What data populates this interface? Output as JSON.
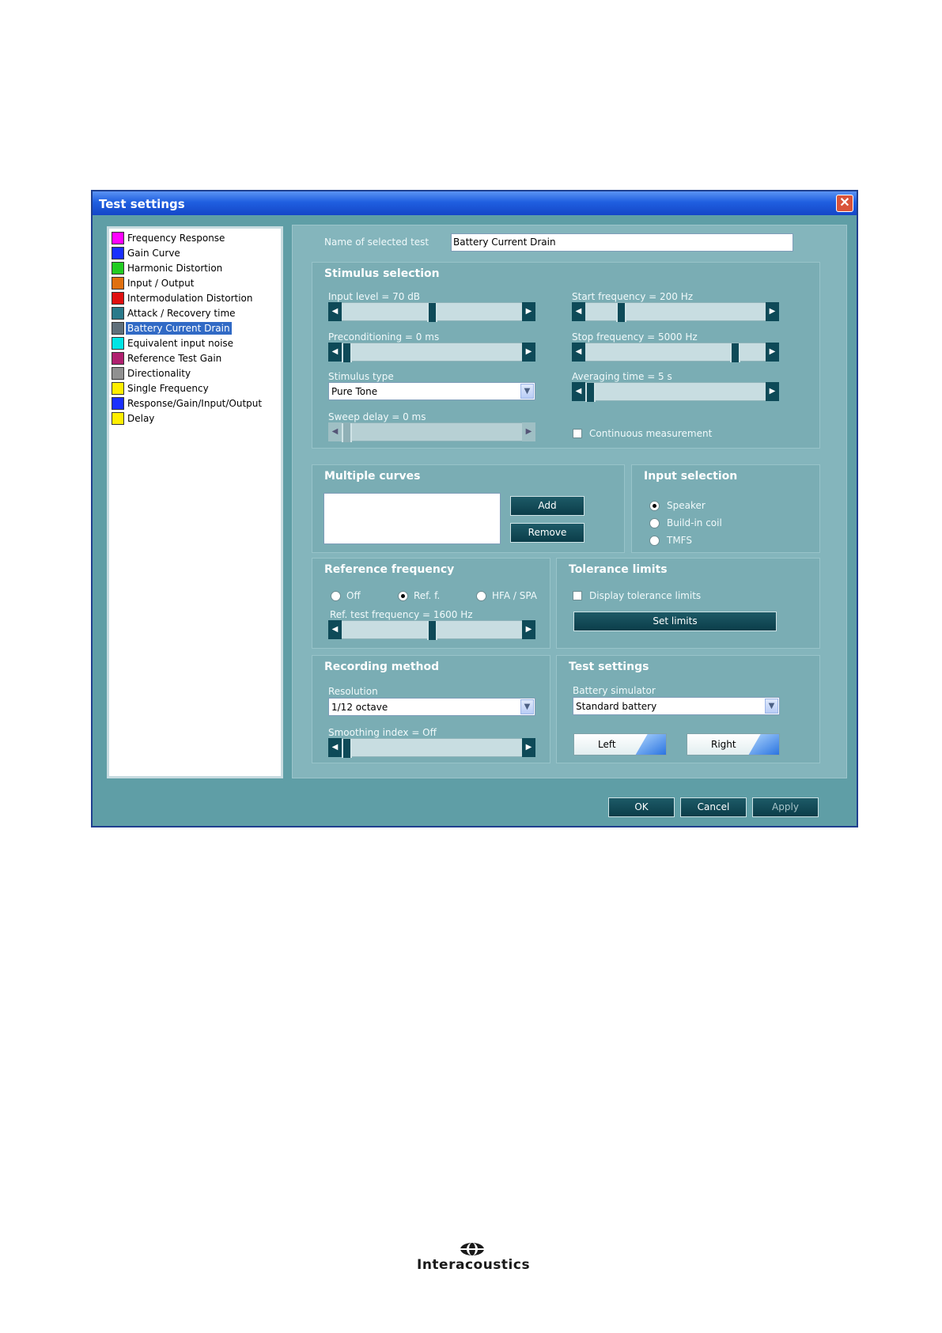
{
  "window": {
    "title": "Test settings",
    "close_symbol": "✕"
  },
  "test_list": [
    {
      "label": "Frequency Response",
      "icon": "frequency-response-icon",
      "color": "#ff00ff"
    },
    {
      "label": "Gain Curve",
      "icon": "gain-curve-icon",
      "color": "#1a2fff"
    },
    {
      "label": "Harmonic Distortion",
      "icon": "harmonic-distortion-icon",
      "color": "#22cc22"
    },
    {
      "label": "Input / Output",
      "icon": "input-output-icon",
      "color": "#e07010"
    },
    {
      "label": "Intermodulation Distortion",
      "icon": "intermodulation-distortion-icon",
      "color": "#e01010"
    },
    {
      "label": "Attack / Recovery time",
      "icon": "attack-recovery-icon",
      "color": "#2a7a8a"
    },
    {
      "label": "Battery Current Drain",
      "icon": "battery-current-drain-icon",
      "color": "#5f6f7a",
      "selected": true
    },
    {
      "label": "Equivalent input noise",
      "icon": "equivalent-input-noise-icon",
      "color": "#00e5e5"
    },
    {
      "label": "Reference Test Gain",
      "icon": "reference-test-gain-icon",
      "color": "#b0206f"
    },
    {
      "label": "Directionality",
      "icon": "directionality-icon",
      "color": "#909090"
    },
    {
      "label": "Single Frequency",
      "icon": "single-frequency-icon",
      "color": "#ffee00"
    },
    {
      "label": "Response/Gain/Input/Output",
      "icon": "response-gain-input-output-icon",
      "color": "#1a2fff"
    },
    {
      "label": "Delay",
      "icon": "delay-icon",
      "color": "#ffee00"
    }
  ],
  "name_of_test": {
    "label": "Name of selected test",
    "value": "Battery Current Drain"
  },
  "stimulus": {
    "title": "Stimulus selection",
    "input_level": {
      "label": "Input level = 70 dB",
      "position": 0.5
    },
    "preconditioning": {
      "label": "Preconditioning = 0 ms",
      "position": 0.0
    },
    "stimulus_type": {
      "label": "Stimulus type",
      "value": "Pure Tone"
    },
    "sweep_delay": {
      "label": "Sweep delay = 0 ms",
      "position": 0.0
    },
    "start_frequency": {
      "label": "Start frequency = 200 Hz",
      "position": 0.18
    },
    "stop_frequency": {
      "label": "Stop frequency = 5000 Hz",
      "position": 0.85
    },
    "averaging_time": {
      "label": "Averaging time = 5 s",
      "position": 0.0
    },
    "continuous": {
      "label": "Continuous measurement",
      "checked": false
    }
  },
  "multiple_curves": {
    "title": "Multiple curves",
    "add": "Add",
    "remove": "Remove"
  },
  "input_selection": {
    "title": "Input selection",
    "options": [
      "Speaker",
      "Build-in coil",
      "TMFS"
    ],
    "selected": "Speaker"
  },
  "reference_frequency": {
    "title": "Reference frequency",
    "options": [
      "Off",
      "Ref. f.",
      "HFA / SPA"
    ],
    "selected": "Ref. f.",
    "ref_test_frequency": {
      "label": "Ref. test frequency = 1600 Hz",
      "position": 0.5
    }
  },
  "tolerance_limits": {
    "title": "Tolerance limits",
    "display_label": "Display tolerance limits",
    "checked": false,
    "set_limits": "Set limits"
  },
  "recording_method": {
    "title": "Recording method",
    "resolution": {
      "label": "Resolution",
      "value": "1/12 octave"
    },
    "smoothing": {
      "label": "Smoothing index = Off",
      "position": 0.0
    }
  },
  "test_settings": {
    "title": "Test settings",
    "battery_simulator": {
      "label": "Battery simulator",
      "value": "Standard battery"
    },
    "left": "Left",
    "right": "Right"
  },
  "footer": {
    "ok": "OK",
    "cancel": "Cancel",
    "apply": "Apply"
  },
  "logo": {
    "text": "Interacoustics"
  }
}
